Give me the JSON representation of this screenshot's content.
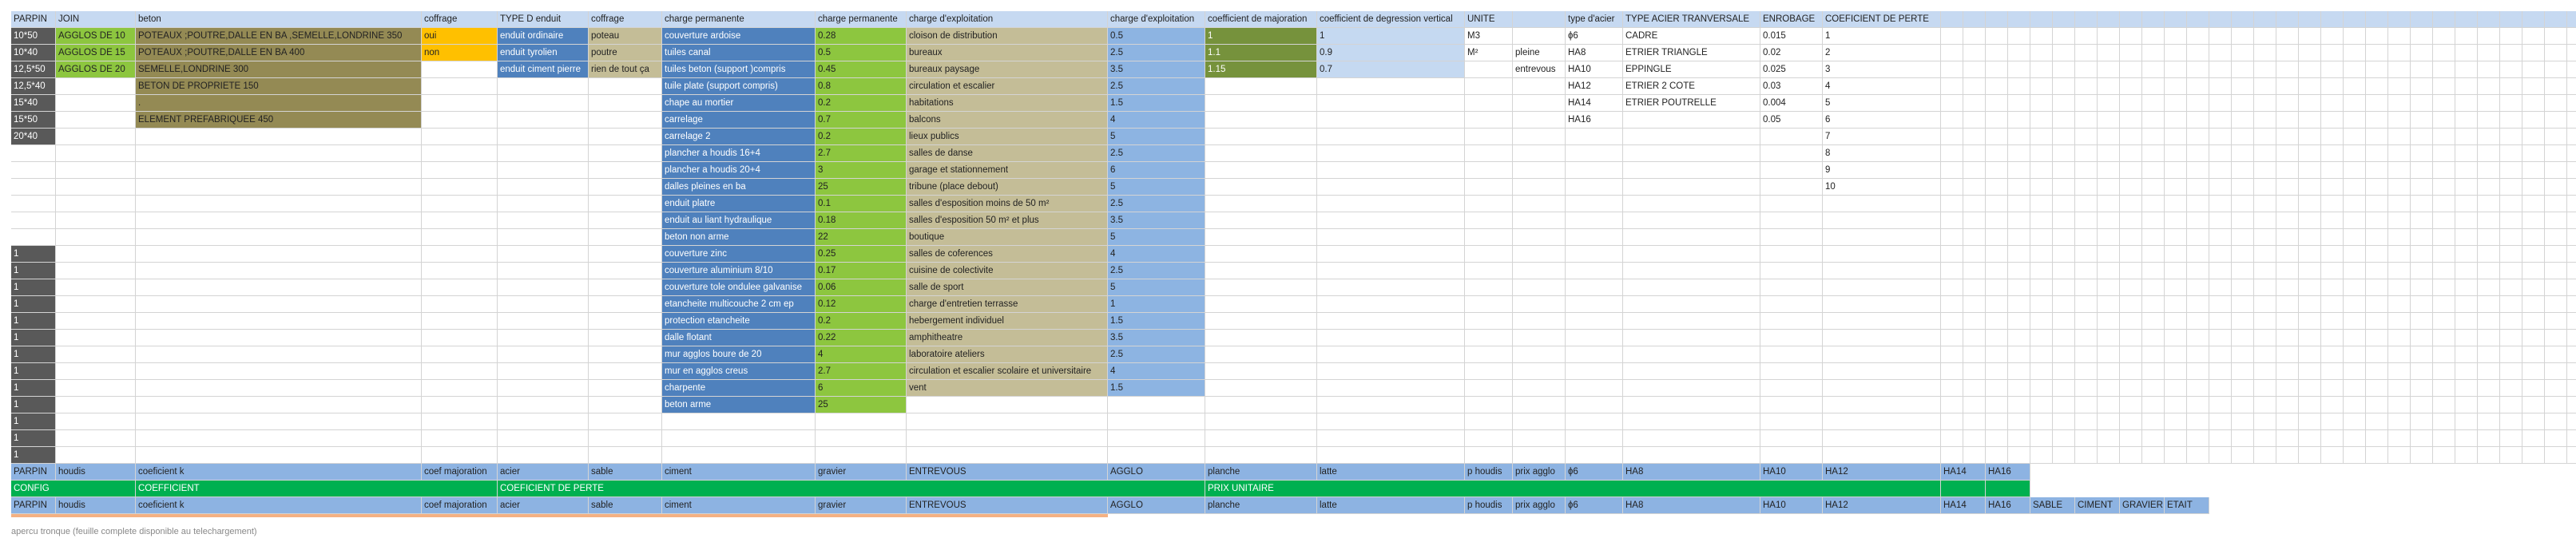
{
  "sheet": {
    "header": [
      "PARPIN",
      "JOIN",
      "beton",
      "coffrage",
      "TYPE D enduit",
      "coffrage",
      "charge permanente",
      "charge permanente",
      "charge d'exploitation",
      "charge d'exploitation",
      "coefficient de majoration",
      "coefficient de degression vertical",
      "UNITE",
      "",
      "type d'acier",
      "TYPE ACIER TRANVERSALE",
      "ENROBAGE",
      "COEFICIENT DE PERTE"
    ],
    "parpin": [
      "10*50",
      "10*40",
      "12,5*50",
      "12,5*40",
      "15*40",
      "15*50",
      "20*40",
      "",
      "",
      "",
      "",
      "",
      "",
      "1",
      "1",
      "1",
      "1",
      "1",
      "1",
      "1",
      "1",
      "1",
      "1",
      "1",
      "1",
      "1"
    ],
    "join": [
      "AGGLOS DE 10",
      "AGGLOS DE 15",
      "AGGLOS DE 20"
    ],
    "beton": [
      "POTEAUX ;POUTRE,DALLE EN BA ,SEMELLE,LONDRINE 350",
      "POTEAUX ;POUTRE,DALLE EN BA 400",
      "SEMELLE,LONDRINE 300",
      "BETON DE PROPRIETE 150",
      ".",
      "ELEMENT PREFABRIQUEE 450"
    ],
    "coffrage": [
      "oui",
      "non"
    ],
    "enduit": [
      "enduit ordinaire",
      "enduit tyrolien",
      "enduit ciment pierre"
    ],
    "coffrage2": [
      "poteau",
      "poutre",
      "rien de tout ça"
    ],
    "perm_names": [
      "couverture ardoise",
      "tuiles canal",
      "tuiles beton (support )compris",
      "tuile plate (support compris)",
      "chape au mortier",
      "carrelage",
      "carrelage 2",
      "plancher a houdis 16+4",
      "plancher a houdis 20+4",
      "dalles pleines en ba",
      "enduit platre",
      "enduit au liant hydraulique",
      "beton non arme",
      "couverture zinc",
      "couverture aluminium 8/10",
      "couverture tole ondulee galvanise",
      "etancheite multicouche 2 cm ep",
      "protection etancheite",
      "dalle flotant",
      "mur agglos boure de 20",
      "mur en agglos creus",
      "charpente",
      "beton arme"
    ],
    "perm_values": [
      "0.28",
      "0.5",
      "0.45",
      "0.8",
      "0.2",
      "0.7",
      "0.2",
      "2.7",
      "3",
      "25",
      "0.1",
      "0.18",
      "22",
      "0.25",
      "0.17",
      "0.06",
      "0.12",
      "0.2",
      "0.22",
      "4",
      "2.7",
      "6",
      "25"
    ],
    "expl_names": [
      "cloison de distribution",
      "bureaux",
      "bureaux paysage",
      "circulation et escalier",
      "habitations",
      "balcons",
      "lieux publics",
      "salles de danse",
      "garage et stationnement",
      "tribune (place debout)",
      "salles d'esposition moins de 50 m²",
      "salles d'esposition 50 m² et plus",
      "boutique",
      "salles de coferences",
      "cuisine de colectivite",
      "salle de sport",
      "charge d'entretien terrasse",
      "hebergement individuel",
      "amphitheatre",
      "laboratoire ateliers",
      "circulation et escalier scolaire et universitaire",
      "vent"
    ],
    "expl_values": [
      "0.5",
      "2.5",
      "3.5",
      "2.5",
      "1.5",
      "4",
      "5",
      "2.5",
      "6",
      "5",
      "2.5",
      "3.5",
      "5",
      "4",
      "2.5",
      "5",
      "1",
      "1.5",
      "3.5",
      "2.5",
      "4",
      "1.5"
    ],
    "majoration": [
      "1",
      "1.1",
      "1.15"
    ],
    "degression": [
      "1",
      "0.9",
      "0.7"
    ],
    "unite": [
      "M3",
      "M²",
      ""
    ],
    "unite2": [
      "",
      "pleine",
      "entrevous"
    ],
    "acier": [
      "ɸ6",
      "HA8",
      "HA10",
      "HA12",
      "HA14",
      "HA16"
    ],
    "acier_trans": [
      "CADRE",
      "ETRIER TRIANGLE",
      "EPPINGLE",
      "ETRIER 2 COTE",
      "ETRIER POUTRELLE"
    ],
    "enrobage": [
      "0.015",
      "0.02",
      "0.025",
      "0.03",
      "0.004",
      "0.05"
    ],
    "perte": [
      "1",
      "2",
      "3",
      "4",
      "5",
      "6",
      "7",
      "8",
      "9",
      "10"
    ],
    "row27": [
      "PARPIN",
      "houdis",
      "coeficient k",
      "coef majoration",
      "acier",
      "sable",
      "ciment",
      "gravier",
      "ENTREVOUS",
      "AGGLO",
      "planche",
      "latte",
      "p houdis",
      "prix agglo",
      "ɸ6",
      "HA8",
      "HA10",
      "HA12",
      "HA14",
      "HA16"
    ],
    "row28": [
      "CONFIG",
      "COEFFICIENT",
      "COEFICIENT DE PERTE",
      "PRIX UNITAIRE"
    ],
    "row29": [
      "PARPIN",
      "houdis",
      "coeficient k",
      "coef majoration",
      "acier",
      "sable",
      "ciment",
      "gravier",
      "ENTREVOUS",
      "AGGLO",
      "planche",
      "latte",
      "p houdis",
      "prix agglo",
      "ɸ6",
      "HA8",
      "HA10",
      "HA12",
      "HA14",
      "HA16",
      "SABLE",
      "CIMENT",
      "GRAVIER",
      "ETAIT"
    ],
    "note": "apercu tronque (feuille complete disponible au telechargement)"
  },
  "colors": {
    "header": "#c6d9f1",
    "dark": "#595959",
    "green": "#8dc63f",
    "olive": "#948a54",
    "orange": "#ffc000",
    "blue": "#4f81bd",
    "tan": "#c4bd97",
    "lightblue": "#8db4e2",
    "olivedark": "#76923c",
    "paleblue": "#c5d9f1",
    "rowblue": "#8db3e2",
    "config": "#00b050"
  }
}
